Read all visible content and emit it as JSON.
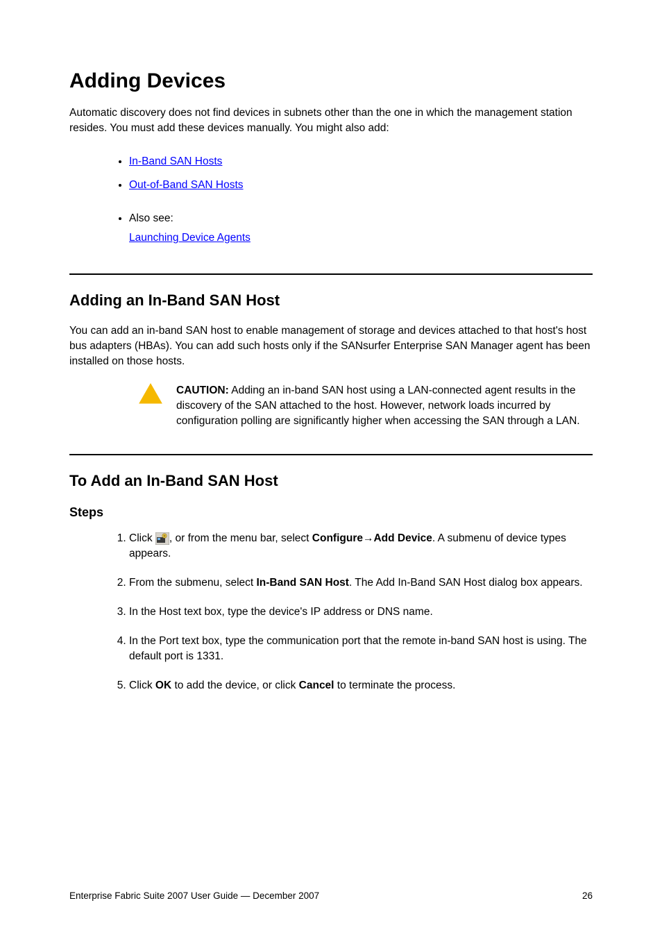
{
  "heading": "Adding Devices",
  "intro": "Automatic discovery does not find devices in subnets other than the one in which the management station resides. You must add these devices manually. You might also add:",
  "links": [
    {
      "text": "In-Band SAN Hosts"
    },
    {
      "text": "Out-of-Band SAN Hosts"
    }
  ],
  "also_see_label": "Also see:",
  "also_see_link": "Launching Device Agents",
  "subsection1": {
    "title": "Adding an In-Band SAN Host",
    "para1": "You can add an in-band SAN host to enable management of storage and devices attached to that host's host bus adapters (HBAs). You can add such hosts only if the SANsurfer Enterprise SAN Manager agent has been installed on those hosts.",
    "caution_label": "CAUTION:",
    "caution_body": " Adding an in-band SAN host using a LAN-connected agent results in the discovery of the SAN attached to the host. However, network loads incurred by configuration polling are significantly higher when accessing the SAN through a LAN."
  },
  "subsection2": {
    "title": "To Add an In-Band SAN Host",
    "steps_heading": "Steps",
    "steps": [
      {
        "pre": "Click ",
        "icon": true,
        "post": ", or from the menu bar, select ",
        "menu1": "Configure",
        "sep": "→",
        "menu2": "Add Device",
        "tail": ". A submenu of device types appears."
      },
      {
        "pre": "From the submenu, select ",
        "bold": "In-Band SAN Host",
        "post": ". The Add In-Band SAN Host dialog box appears."
      },
      {
        "text": "In the Host text box, type the device's IP address or DNS name."
      },
      {
        "text": "In the Port text box, type the communication port that the remote in-band SAN host is using. The default port is 1331."
      },
      {
        "pre": "Click ",
        "bold": "OK",
        "post": " to add the device, or click ",
        "bold2": "Cancel",
        "post2": " to terminate the process."
      }
    ]
  },
  "footer": {
    "left": "Enterprise Fabric Suite 2007 User Guide — December 2007",
    "right": "26"
  }
}
